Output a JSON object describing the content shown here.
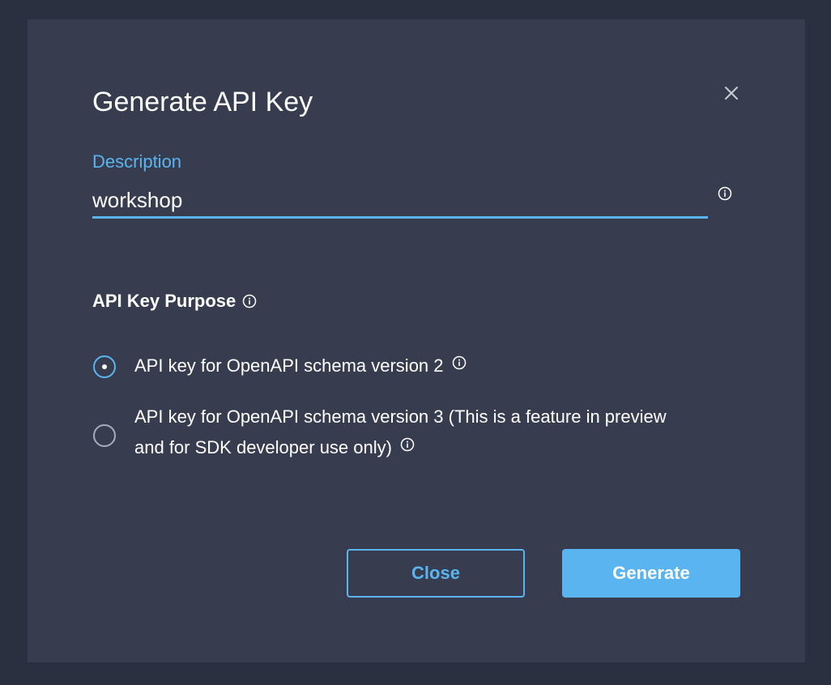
{
  "dialog": {
    "title": "Generate API Key",
    "close_icon": "close-icon"
  },
  "description": {
    "label": "Description",
    "value": "workshop",
    "info_icon": "info-icon"
  },
  "purpose": {
    "heading": "API Key Purpose",
    "info_icon": "info-icon",
    "options": [
      {
        "label": "API key for OpenAPI schema version 2",
        "selected": true
      },
      {
        "label_line1": "API key for OpenAPI schema version 3 (This is a feature in preview",
        "label_line2": "and for SDK developer use only)",
        "selected": false
      }
    ]
  },
  "actions": {
    "close_label": "Close",
    "generate_label": "Generate"
  },
  "colors": {
    "accent": "#5ab4ef",
    "dialog_bg": "#373d4f",
    "backdrop": "#2b3040"
  }
}
